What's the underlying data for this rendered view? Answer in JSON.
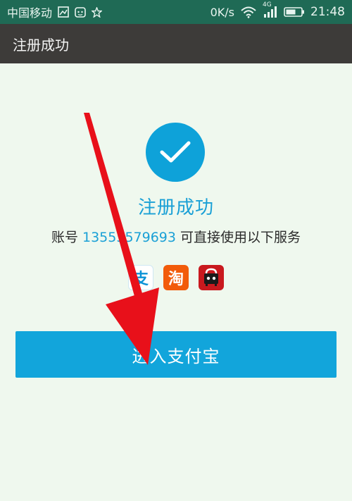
{
  "status_bar": {
    "carrier": "中国移动",
    "speed": "0K/s",
    "network": "4G",
    "time": "21:48",
    "icons": [
      "gallery-icon",
      "android-app-icon",
      "star-icon",
      "wifi-icon",
      "signal-icon",
      "battery-icon"
    ]
  },
  "header": {
    "title": "注册成功"
  },
  "success": {
    "icon": "checkmark-icon",
    "title": "注册成功",
    "account_prefix": "账号",
    "account_number": "13555579693",
    "account_suffix": "可直接使用以下服务"
  },
  "services": [
    {
      "name": "alipay",
      "glyph": "支"
    },
    {
      "name": "taobao",
      "glyph": "淘"
    },
    {
      "name": "tmall",
      "glyph": ""
    }
  ],
  "action": {
    "button_label": "进入支付宝"
  },
  "colors": {
    "status_bar": "#1f6a55",
    "title_bar": "#3d3b39",
    "accent": "#12a5db",
    "background": "#eff8ee",
    "annotation_arrow": "#e8101a"
  }
}
